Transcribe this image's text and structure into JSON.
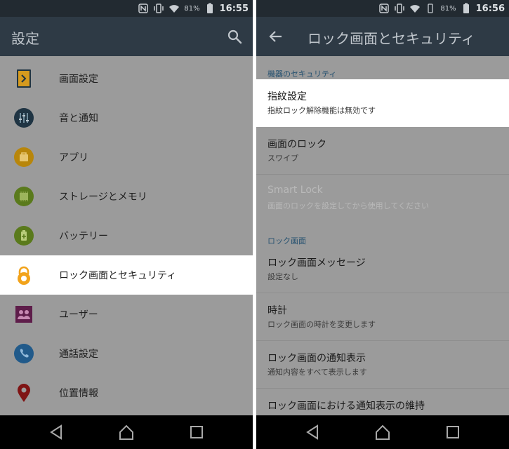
{
  "left": {
    "status": {
      "battery_pct": "81%",
      "time": "16:55"
    },
    "appbar": {
      "title": "設定"
    },
    "items": [
      {
        "label": "画面設定",
        "icon": "display-icon"
      },
      {
        "label": "音と通知",
        "icon": "sound-icon"
      },
      {
        "label": "アプリ",
        "icon": "apps-icon"
      },
      {
        "label": "ストレージとメモリ",
        "icon": "storage-icon"
      },
      {
        "label": "バッテリー",
        "icon": "battery-icon"
      },
      {
        "label": "ロック画面とセキュリティ",
        "icon": "lock-icon",
        "highlighted": true
      },
      {
        "label": "ユーザー",
        "icon": "users-icon"
      },
      {
        "label": "通話設定",
        "icon": "phone-icon"
      },
      {
        "label": "位置情報",
        "icon": "location-icon"
      }
    ]
  },
  "right": {
    "status": {
      "battery_pct": "81%",
      "time": "16:56"
    },
    "appbar": {
      "title": "ロック画面とセキュリティ"
    },
    "section1": {
      "header": "機器のセキュリティ"
    },
    "prefs1": [
      {
        "title": "指紋設定",
        "summary": "指紋ロック解除機能は無効です",
        "highlighted": true
      },
      {
        "title": "画面のロック",
        "summary": "スワイプ"
      },
      {
        "title": "Smart Lock",
        "summary": "画面のロックを設定してから使用してください",
        "disabled": true
      }
    ],
    "section2": {
      "header": "ロック画面"
    },
    "prefs2": [
      {
        "title": "ロック画面メッセージ",
        "summary": "設定なし"
      },
      {
        "title": "時計",
        "summary": "ロック画面の時計を変更します"
      },
      {
        "title": "ロック画面の通知表示",
        "summary": "通知内容をすべて表示します"
      },
      {
        "title": "ロック画面における通知表示の維持",
        "summary": ""
      }
    ]
  },
  "colors": {
    "status_bar": "#222a31",
    "app_bar": "#2e3a45",
    "dim_overlay": "#9b9b9b",
    "highlight": "#ffffff",
    "accent_lock": "#f2a31b",
    "section_header": "#24506f"
  }
}
